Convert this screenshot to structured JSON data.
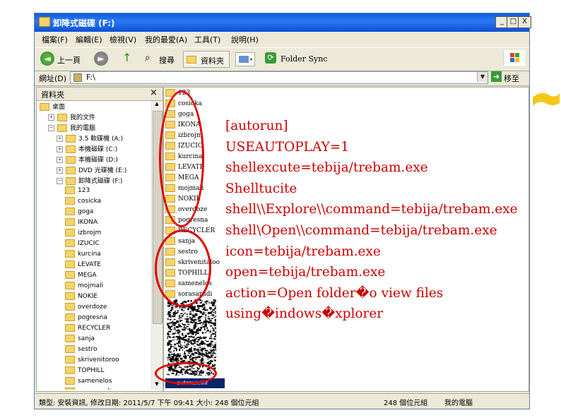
{
  "window": {
    "title": "卸降式磁碟 (F:)",
    "buttons": {
      "minimize": "_",
      "maximize": "□",
      "close": "X"
    }
  },
  "menu": [
    "檔案(F)",
    "編輯(E)",
    "檢視(V)",
    "我的最愛(A)",
    "工具(T)",
    "說明(H)"
  ],
  "toolbar": {
    "back": "上一頁",
    "search": "搜尋",
    "folders": "資料夾",
    "folder_sync": "Folder Sync"
  },
  "address": {
    "label": "網址(D)",
    "value": "F:\\",
    "go": "移至"
  },
  "folder_pane": {
    "title": "資料夾",
    "close": "×",
    "tree": [
      {
        "label": "桌面",
        "indent": 0
      },
      {
        "label": "我的文件",
        "indent": 1
      },
      {
        "label": "我的電腦",
        "indent": 1
      },
      {
        "label": "3.5 軟碟機 (A:)",
        "indent": 2
      },
      {
        "label": "本機磁碟 (C:)",
        "indent": 2
      },
      {
        "label": "本機磁碟 (D:)",
        "indent": 2
      },
      {
        "label": "DVD 光碟機 (E:)",
        "indent": 2
      },
      {
        "label": "卸降式磁碟 (F:)",
        "indent": 2
      },
      {
        "label": "123",
        "indent": 3
      },
      {
        "label": "cosicka",
        "indent": 3
      },
      {
        "label": "goga",
        "indent": 3
      },
      {
        "label": "IKONA",
        "indent": 3
      },
      {
        "label": "izbrojm",
        "indent": 3
      },
      {
        "label": "IZUCIC",
        "indent": 3
      },
      {
        "label": "kurcina",
        "indent": 3
      },
      {
        "label": "LEVATE",
        "indent": 3
      },
      {
        "label": "MEGA",
        "indent": 3
      },
      {
        "label": "mojmali",
        "indent": 3
      },
      {
        "label": "NOKIE",
        "indent": 3
      },
      {
        "label": "overdoze",
        "indent": 3
      },
      {
        "label": "pogresna",
        "indent": 3
      },
      {
        "label": "RECYCLER",
        "indent": 3
      },
      {
        "label": "sanja",
        "indent": 3
      },
      {
        "label": "sestro",
        "indent": 3
      },
      {
        "label": "skrivenitoroo",
        "indent": 3
      },
      {
        "label": "TOPHILL",
        "indent": 3
      },
      {
        "label": "samenelos",
        "indent": 3
      },
      {
        "label": "sorasarudi",
        "indent": 3
      }
    ]
  },
  "files": [
    "123",
    "cosicka",
    "goga",
    "IKONA",
    "izbrojm",
    "IZUCIC",
    "kurcina",
    "LEVATE",
    "MEGA",
    "mojmali",
    "NOKIE",
    "overdoze",
    "pogresna",
    "RECYCLER",
    "sanja",
    "sestro",
    "skrivenitaloo",
    "TOPHILL",
    "samenelos",
    "sorasarudi"
  ],
  "selected_file": "autorun.inf",
  "status": {
    "info": "類型: 安裝資訊, 修改日期: 2011/5/7 下午 09:41 大小: 248 個位元組",
    "size": "248 個位元組",
    "location": "我的電腦"
  },
  "overlay_text": [
    "[autorun]",
    "USEAUTOPLAY=1",
    "shellexcute=tebija/trebam.exe",
    "Shelltucite",
    "shell\\\\Explore\\\\command=tebija/trebam.exe",
    "shell\\Open\\\\command=tebija/trebam.exe",
    "icon=tebija/trebam.exe",
    "open=tebija/trebam.exe",
    "action=Open folder�o view files",
    "using�indows�xplorer"
  ],
  "colors": {
    "annotation": "#cc0000",
    "titlebar": "#0a5ddc",
    "highlighter": "#f2c200"
  }
}
